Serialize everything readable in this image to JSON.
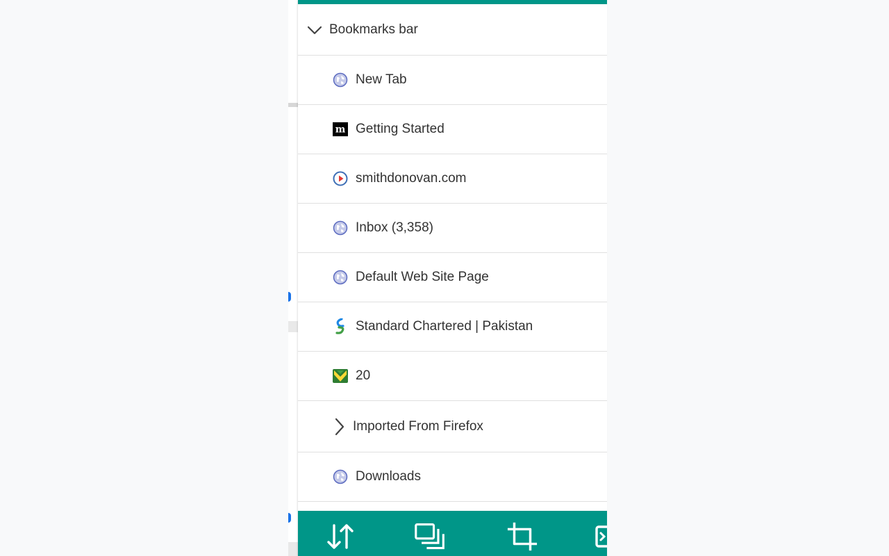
{
  "colors": {
    "accent": "#009688",
    "text": "#333333",
    "divider": "#e0e0e0"
  },
  "folder": {
    "label": "Bookmarks bar",
    "icon": "chevron-down-icon"
  },
  "items": [
    {
      "label": "New Tab",
      "icon": "globe-icon"
    },
    {
      "label": "Getting Started",
      "icon": "medium-m-icon"
    },
    {
      "label": "smithdonovan.com",
      "icon": "play-circle-icon"
    },
    {
      "label": "Inbox (3,358)",
      "icon": "globe-icon"
    },
    {
      "label": "Default Web Site Page",
      "icon": "globe-icon"
    },
    {
      "label": "Standard Chartered | Pakistan",
      "icon": "standard-chartered-icon"
    },
    {
      "label": "20",
      "icon": "map-icon"
    },
    {
      "label": "Imported From Firefox",
      "icon": "chevron-right-icon"
    },
    {
      "label": "Downloads",
      "icon": "globe-icon"
    }
  ],
  "toolbar": [
    {
      "icon": "sort-icon"
    },
    {
      "icon": "copy-icon"
    },
    {
      "icon": "crop-icon"
    },
    {
      "icon": "next-icon"
    }
  ]
}
